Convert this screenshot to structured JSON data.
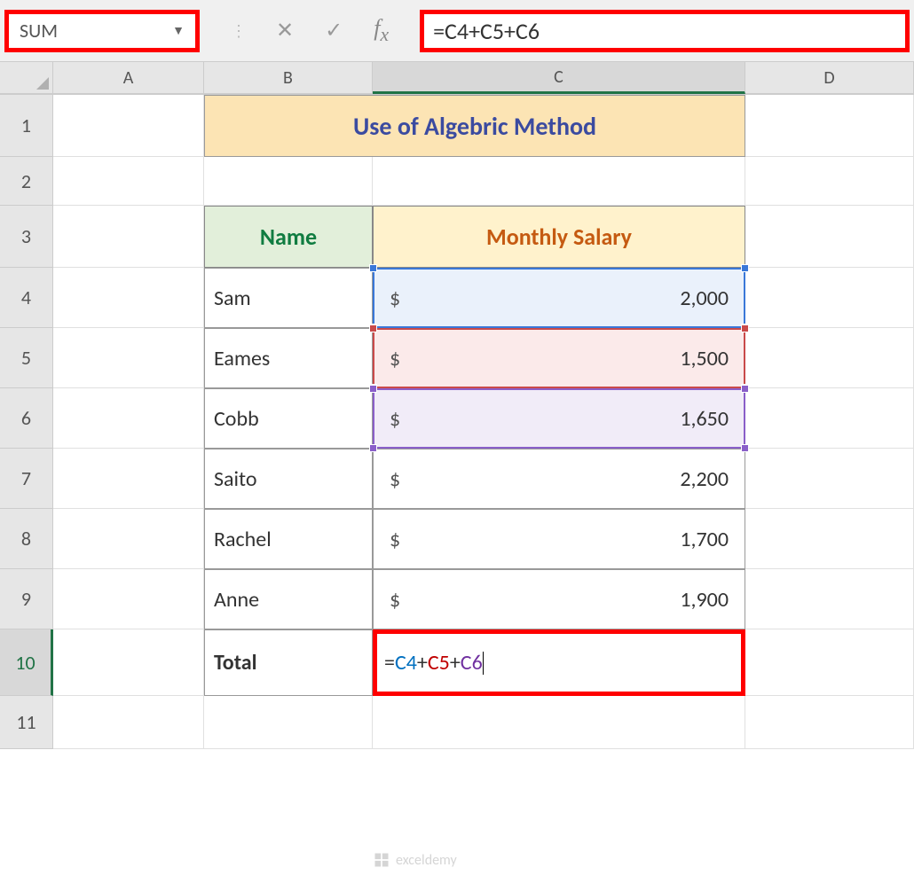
{
  "name_box": "SUM",
  "formula_bar": "=C4+C5+C6",
  "columns": [
    "A",
    "B",
    "C",
    "D"
  ],
  "row_numbers": [
    "1",
    "2",
    "3",
    "4",
    "5",
    "6",
    "7",
    "8",
    "9",
    "10",
    "11"
  ],
  "title": "Use of Algebric Method",
  "headers": {
    "name": "Name",
    "salary": "Monthly Salary"
  },
  "rows": [
    {
      "name": "Sam",
      "currency": "$",
      "amount": "2,000"
    },
    {
      "name": "Eames",
      "currency": "$",
      "amount": "1,500"
    },
    {
      "name": "Cobb",
      "currency": "$",
      "amount": "1,650"
    },
    {
      "name": "Saito",
      "currency": "$",
      "amount": "2,200"
    },
    {
      "name": "Rachel",
      "currency": "$",
      "amount": "1,700"
    },
    {
      "name": "Anne",
      "currency": "$",
      "amount": "1,900"
    }
  ],
  "total_label": "Total",
  "formula_cell": {
    "eq": "=",
    "r1": "C4",
    "p1": "+",
    "r2": "C5",
    "p2": "+",
    "r3": "C6"
  },
  "watermark": "exceldemy"
}
